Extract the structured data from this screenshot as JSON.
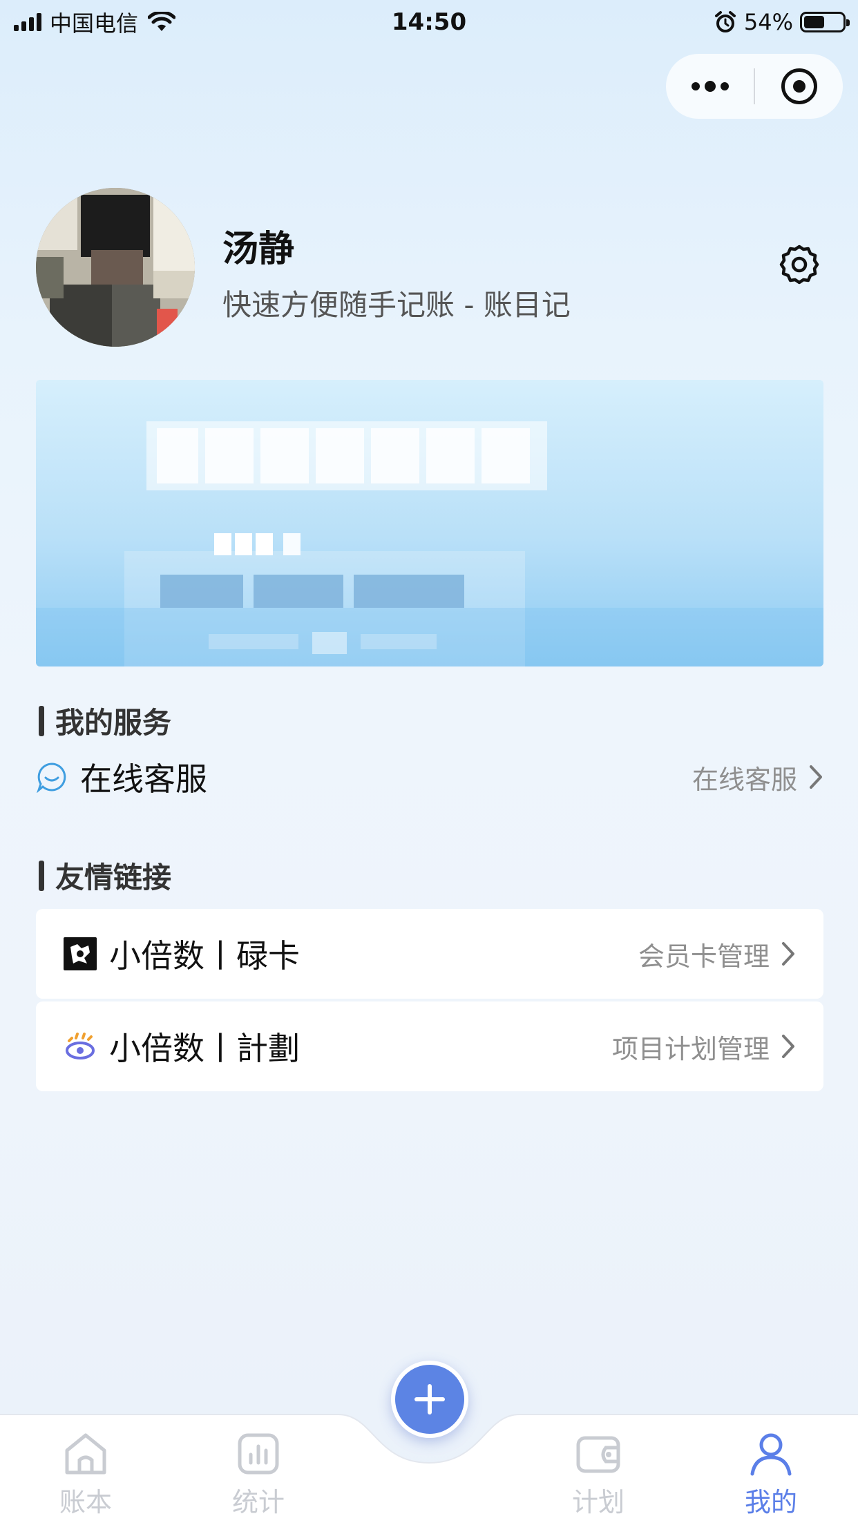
{
  "status_bar": {
    "carrier": "中国电信",
    "time": "14:50",
    "battery_percent": "54%",
    "battery_level": 0.54
  },
  "profile": {
    "name": "汤静",
    "slogan": "快速方便随手记账 - 账目记"
  },
  "services": {
    "title": "我的服务",
    "items": [
      {
        "label": "在线客服",
        "hint": "在线客服",
        "icon": "chat-bubble-icon"
      }
    ]
  },
  "links": {
    "title": "友情链接",
    "items": [
      {
        "label": "小倍数丨碌卡",
        "hint": "会员卡管理",
        "icon": "card-app-logo-icon"
      },
      {
        "label": "小倍数丨計劃",
        "hint": "项目计划管理",
        "icon": "plan-app-logo-icon"
      }
    ]
  },
  "tabbar": {
    "items": [
      {
        "label": "账本",
        "icon": "home-icon",
        "active": false
      },
      {
        "label": "统计",
        "icon": "chart-icon",
        "active": false
      },
      {
        "label": "计划",
        "icon": "wallet-icon",
        "active": false
      },
      {
        "label": "我的",
        "icon": "user-icon",
        "active": true
      }
    ],
    "add_icon": "plus-icon"
  },
  "colors": {
    "accent": "#5b7fe8",
    "inactive_tab": "#c9ccd2",
    "hint_text": "#8f8f8f"
  }
}
